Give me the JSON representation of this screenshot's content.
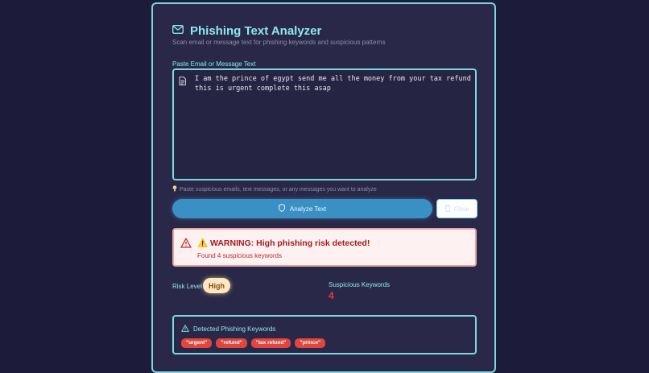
{
  "header": {
    "title": "Phishing Text Analyzer",
    "subtitle": "Scan email or message text for phishing keywords and suspicious patterns"
  },
  "input": {
    "label": "Paste Email or Message Text",
    "value": "I am the prince of egypt send me all the money from your tax refund this is urgent complete this asap",
    "hint": "Paste suspicious emails, text messages, or any messages you want to analyze"
  },
  "actions": {
    "analyze_label": "Analyze Text",
    "clear_label": "Clear"
  },
  "warning": {
    "title": "⚠️ WARNING: High phishing risk detected!",
    "message": "Found 4 suspicious keywords"
  },
  "stats": {
    "risk_label": "Risk Level",
    "risk_value": "High",
    "keywords_label": "Suspicious Keywords",
    "keywords_count": "4"
  },
  "detected": {
    "title": "Detected Phishing Keywords",
    "keywords": [
      "\"urgent\"",
      "\"refund\"",
      "\"tax refund\"",
      "\"prince\""
    ]
  },
  "colors": {
    "background": "#1d1b3a",
    "accent": "#7cd7de",
    "danger": "#e0463f",
    "button": "#3a8fc4"
  }
}
